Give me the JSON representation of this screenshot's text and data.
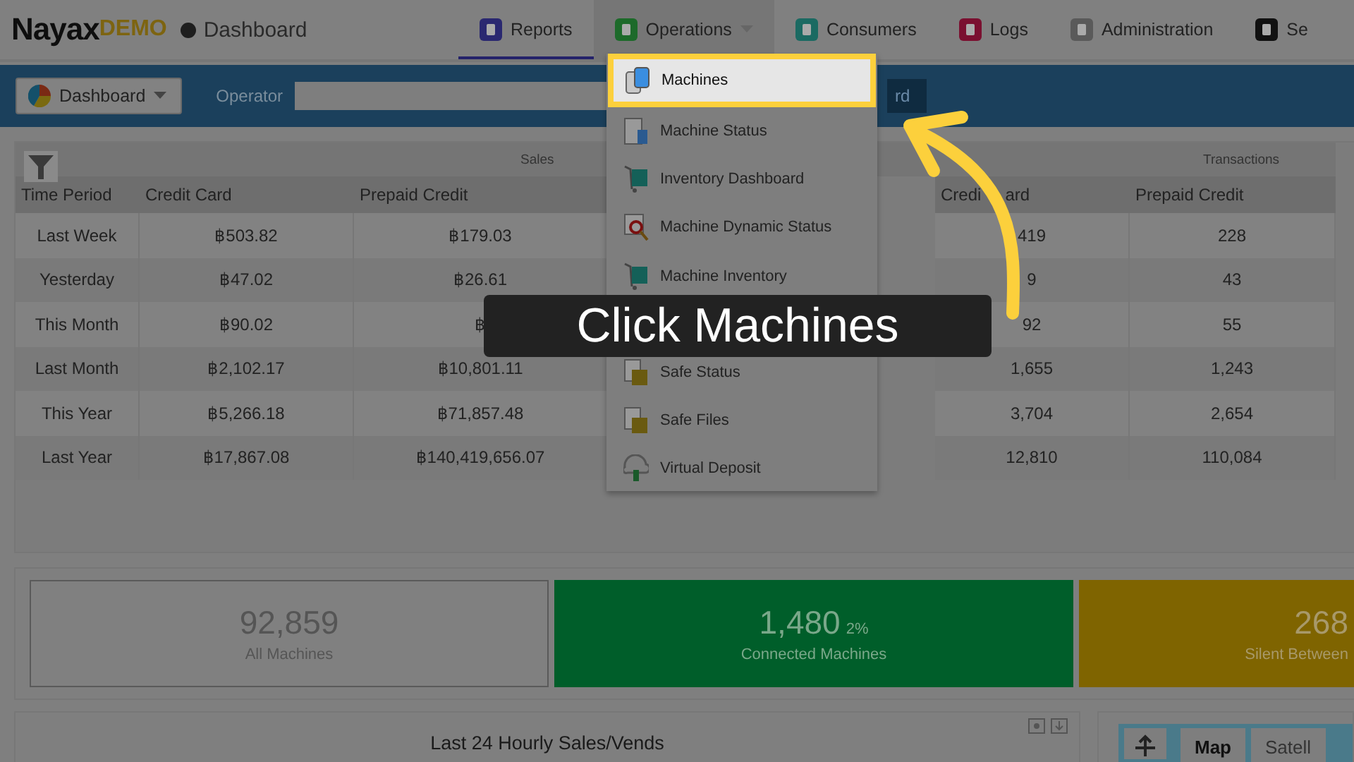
{
  "header": {
    "logo_name": "Nayax",
    "logo_suffix": "DEMO",
    "page_title": "Dashboard"
  },
  "nav": [
    {
      "label": "Reports",
      "selected": true,
      "expanded": false
    },
    {
      "label": "Operations",
      "selected": false,
      "expanded": true
    },
    {
      "label": "Consumers",
      "selected": false,
      "expanded": false
    },
    {
      "label": "Logs",
      "selected": false,
      "expanded": false
    },
    {
      "label": "Administration",
      "selected": false,
      "expanded": false
    },
    {
      "label": "Se",
      "selected": false,
      "expanded": false
    }
  ],
  "toolbar": {
    "view_selector": "Dashboard",
    "operator_label": "Operator",
    "button_fragment": "rd"
  },
  "table": {
    "groups": [
      "Sales",
      "Transactions"
    ],
    "columns": [
      "Time Period",
      "Credit Card",
      "Prepaid Credit",
      "Credi",
      "Prepaid Credit"
    ],
    "column_4_tail": "ard",
    "rows": [
      [
        "Last Week",
        "฿503.82",
        "฿179.03",
        "419",
        "228"
      ],
      [
        "Yesterday",
        "฿47.02",
        "฿26.61",
        "9",
        "43"
      ],
      [
        "This Month",
        "฿90.02",
        "฿",
        "92",
        "55"
      ],
      [
        "Last Month",
        "฿2,102.17",
        "฿10,801.11",
        "1,655",
        "1,243"
      ],
      [
        "This Year",
        "฿5,266.18",
        "฿71,857.48",
        "3,704",
        "2,654"
      ],
      [
        "Last Year",
        "฿17,867.08",
        "฿140,419,656.07",
        "12,810",
        "110,084"
      ]
    ]
  },
  "menu": [
    {
      "label": "Machines",
      "selected": true
    },
    {
      "label": "Machine Status",
      "selected": false
    },
    {
      "label": "Inventory Dashboard",
      "selected": false
    },
    {
      "label": "Machine Dynamic Status",
      "selected": false
    },
    {
      "label": "Machine Inventory",
      "selected": false
    },
    {
      "label": "Safe Status",
      "selected": false
    },
    {
      "label": "Safe Files",
      "selected": false
    },
    {
      "label": "Virtual Deposit",
      "selected": false
    }
  ],
  "caption": "Click Machines",
  "stats": [
    {
      "kind": "plain",
      "value": "92,859",
      "label": "All Machines"
    },
    {
      "kind": "green",
      "value": "1,480",
      "percent": "2%",
      "label": "Connected Machines"
    },
    {
      "kind": "amber",
      "value": "268",
      "label": "Silent Between"
    }
  ],
  "chart_panel": {
    "title": "Last 24 Hourly Sales/Vends"
  },
  "map_panel": {
    "tabs": [
      {
        "label": "Map",
        "selected": true
      },
      {
        "label": "Satell",
        "selected": false
      }
    ]
  }
}
